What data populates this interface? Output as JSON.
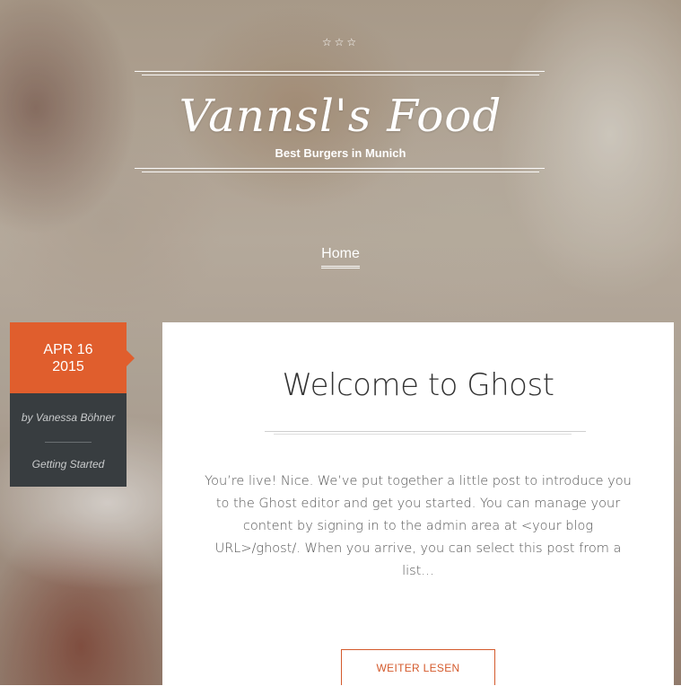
{
  "header": {
    "stars": "☆☆☆",
    "site_title": "Vannsl's Food",
    "tagline": "Best Burgers in Munich"
  },
  "nav": {
    "home_label": "Home"
  },
  "post": {
    "date_line1": "APR 16",
    "date_line2": "2015",
    "author": "by Vanessa Böhner",
    "tag": "Getting Started",
    "title": "Welcome to Ghost",
    "excerpt": "You’re live! Nice. We’ve put together a little post to introduce you to the Ghost editor and get you started. You can manage your content by signing in to the admin area at <your blog URL>/ghost/. When you arrive, you can select this post from a list…",
    "read_more_label": "WEITER LESEN"
  },
  "colors": {
    "accent": "#e05e2d",
    "meta_dark": "#383d40",
    "card_bg": "#ffffff"
  }
}
